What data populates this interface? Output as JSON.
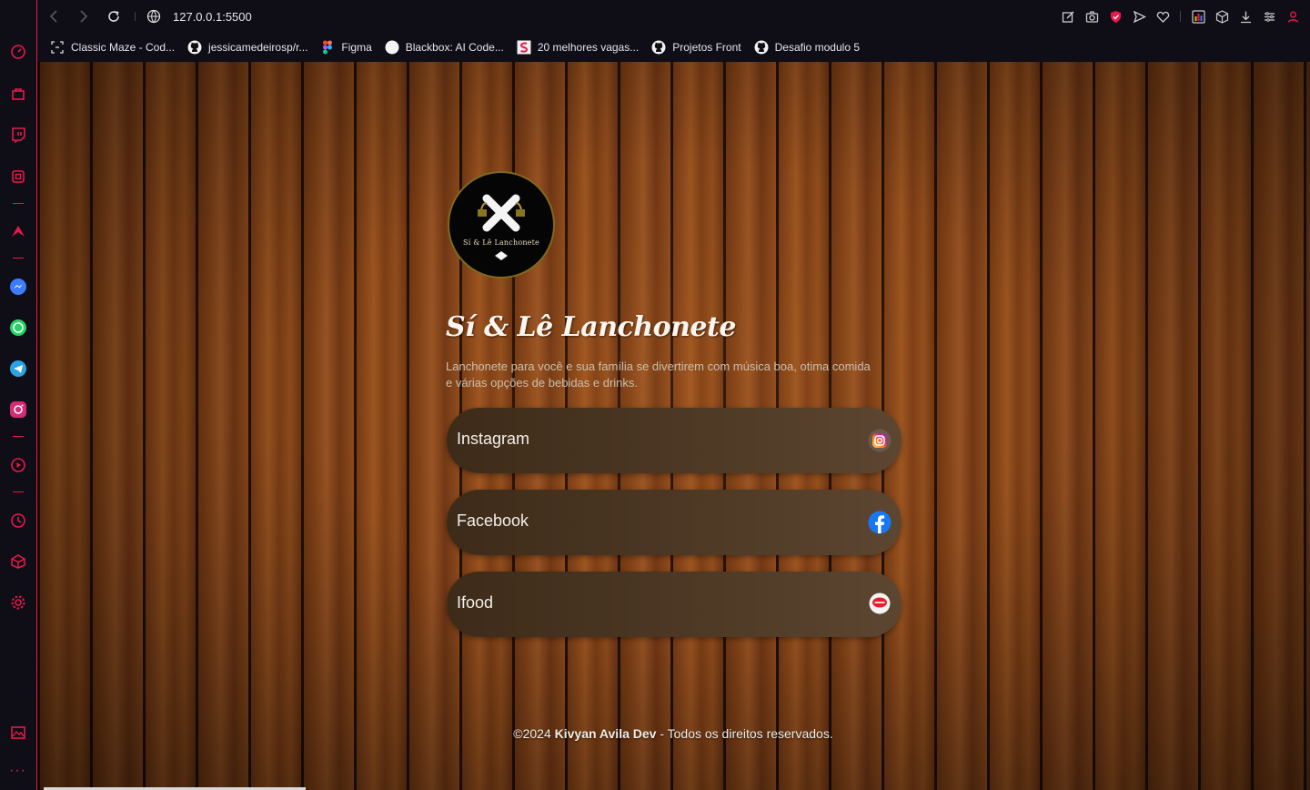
{
  "browser": {
    "url": "127.0.0.1:5500",
    "bookmarks": [
      {
        "label": "Classic Maze - Cod...",
        "icon": "maze-icon"
      },
      {
        "label": "jessicamedeirosp/r...",
        "icon": "github-icon"
      },
      {
        "label": "Figma",
        "icon": "figma-icon"
      },
      {
        "label": "Blackbox: AI Code...",
        "icon": "blackbox-icon"
      },
      {
        "label": "20 melhores vagas...",
        "icon": "jobs-icon"
      },
      {
        "label": "Projetos Front",
        "icon": "github-icon"
      },
      {
        "label": "Desafio modulo 5",
        "icon": "github-icon"
      }
    ],
    "accent_color": "#e8194a"
  },
  "page": {
    "logo_text": "Sí & Lê Lanchonete",
    "title": "Sí & Lê Lanchonete",
    "description": "Lanchonete para você e sua família se divertirem com música boa, otima comida e várias opções de bebidas e drinks.",
    "links": [
      {
        "label": "Instagram",
        "icon": "instagram-icon"
      },
      {
        "label": "Facebook",
        "icon": "facebook-icon"
      },
      {
        "label": "Ifood",
        "icon": "ifood-icon"
      }
    ],
    "footer": {
      "prefix": "©2024 ",
      "author": "Kivyan Avila Dev",
      "suffix": " - Todos os direitos reservados."
    }
  }
}
